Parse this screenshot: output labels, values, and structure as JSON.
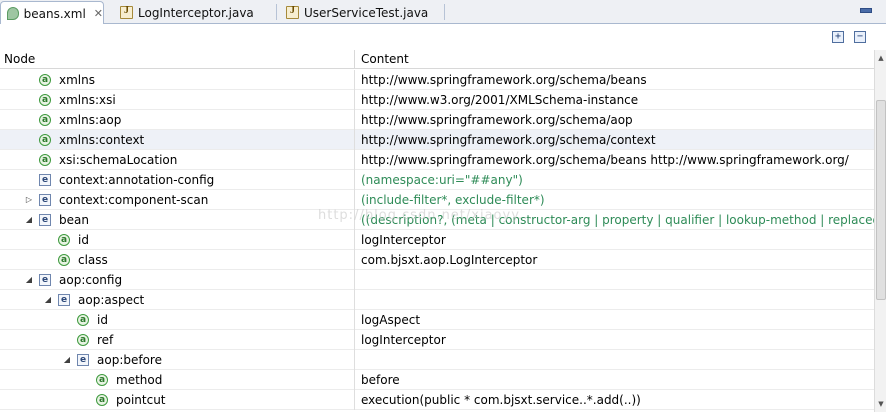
{
  "tabs": [
    {
      "label": "beans.xml",
      "icon": "xml-file-icon",
      "active": true,
      "close": "✕"
    },
    {
      "label": "LogInterceptor.java",
      "icon": "java-file-icon",
      "active": false
    },
    {
      "label": "UserServiceTest.java",
      "icon": "java-file-icon",
      "active": false
    }
  ],
  "toolbar": {
    "expand_all": "+",
    "collapse_all": "−"
  },
  "columns": {
    "node": "Node",
    "content": "Content"
  },
  "watermark": "http://blog.csdn.net/xiaoyy...",
  "rows": [
    {
      "kind": "attr",
      "depth": 1,
      "twisty": "",
      "node": "xmlns",
      "content": "http://www.springframework.org/schema/beans",
      "hint": false
    },
    {
      "kind": "attr",
      "depth": 1,
      "twisty": "",
      "node": "xmlns:xsi",
      "content": "http://www.w3.org/2001/XMLSchema-instance",
      "hint": false
    },
    {
      "kind": "attr",
      "depth": 1,
      "twisty": "",
      "node": "xmlns:aop",
      "content": "http://www.springframework.org/schema/aop",
      "hint": false
    },
    {
      "kind": "attr",
      "depth": 1,
      "twisty": "",
      "node": "xmlns:context",
      "content": "http://www.springframework.org/schema/context",
      "hint": false,
      "selected": true
    },
    {
      "kind": "attr",
      "depth": 1,
      "twisty": "",
      "node": "xsi:schemaLocation",
      "content": "http://www.springframework.org/schema/beans             http://www.springframework.org/",
      "hint": false
    },
    {
      "kind": "elem",
      "depth": 1,
      "twisty": "",
      "node": "context:annotation-config",
      "content": "(namespace:uri=\"##any\")",
      "hint": true
    },
    {
      "kind": "elem",
      "depth": 1,
      "twisty": "▷",
      "node": "context:component-scan",
      "content": "(include-filter*, exclude-filter*)",
      "hint": true
    },
    {
      "kind": "elem",
      "depth": 1,
      "twisty": "◢",
      "node": "bean",
      "content": "((description?, (meta | constructor-arg | property | qualifier | lookup-method | replaced-...",
      "hint": true
    },
    {
      "kind": "attr",
      "depth": 2,
      "twisty": "",
      "node": "id",
      "content": "logInterceptor",
      "hint": false
    },
    {
      "kind": "attr",
      "depth": 2,
      "twisty": "",
      "node": "class",
      "content": "com.bjsxt.aop.LogInterceptor",
      "hint": false
    },
    {
      "kind": "elem",
      "depth": 1,
      "twisty": "◢",
      "node": "aop:config",
      "content": "",
      "hint": false
    },
    {
      "kind": "elem",
      "depth": 2,
      "twisty": "◢",
      "node": "aop:aspect",
      "content": "",
      "hint": false
    },
    {
      "kind": "attr",
      "depth": 3,
      "twisty": "",
      "node": "id",
      "content": "logAspect",
      "hint": false
    },
    {
      "kind": "attr",
      "depth": 3,
      "twisty": "",
      "node": "ref",
      "content": "logInterceptor",
      "hint": false
    },
    {
      "kind": "elem",
      "depth": 3,
      "twisty": "◢",
      "node": "aop:before",
      "content": "",
      "hint": false
    },
    {
      "kind": "attr",
      "depth": 4,
      "twisty": "",
      "node": "method",
      "content": "before",
      "hint": false
    },
    {
      "kind": "attr",
      "depth": 4,
      "twisty": "",
      "node": "pointcut",
      "content": "execution(public * com.bjsxt.service..*.add(..))",
      "hint": false
    }
  ],
  "icon_glyphs": {
    "attr": "a",
    "elem": "e"
  },
  "colors": {
    "hint_text": "#2e8b57",
    "tab_border": "#a9b8cf",
    "selected_row": "#eef1f7"
  }
}
